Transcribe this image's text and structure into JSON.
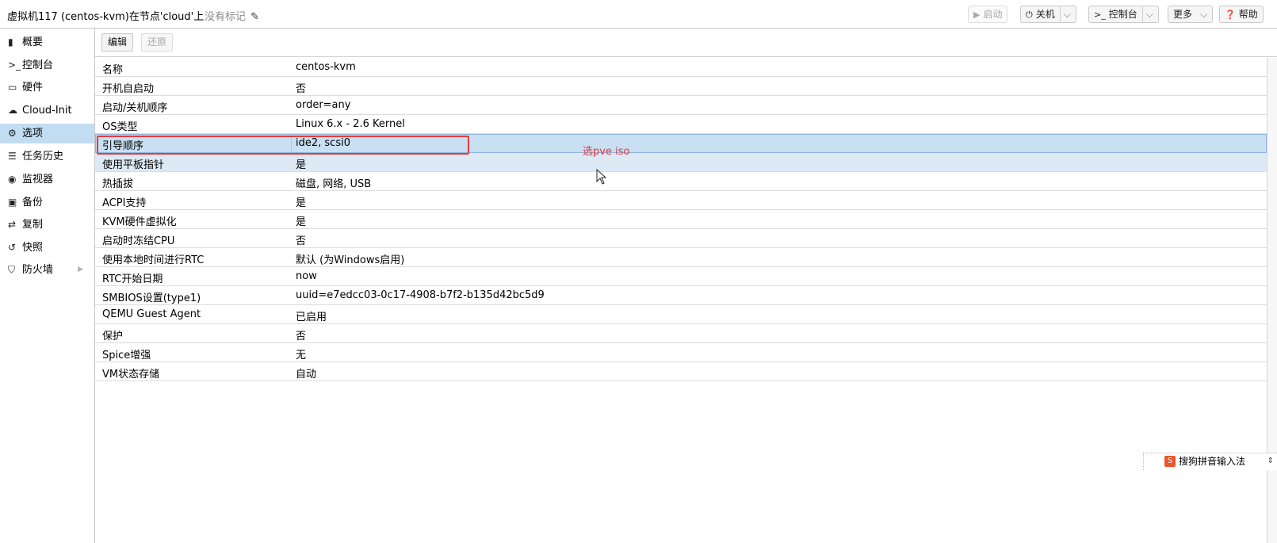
{
  "header": {
    "title": "虚拟机117 (centos-kvm)在节点'cloud'上",
    "tags": "没有标记",
    "buttons": {
      "start": "启动",
      "shutdown": "关机",
      "console": "控制台",
      "more": "更多",
      "help": "帮助"
    }
  },
  "sidebar": {
    "items": [
      {
        "label": "概要",
        "icon": "book-icon"
      },
      {
        "label": "控制台",
        "icon": "terminal-icon"
      },
      {
        "label": "硬件",
        "icon": "monitor-icon"
      },
      {
        "label": "Cloud-Init",
        "icon": "cloud-icon"
      },
      {
        "label": "选项",
        "icon": "gear-icon",
        "active": true
      },
      {
        "label": "任务历史",
        "icon": "list-icon"
      },
      {
        "label": "监视器",
        "icon": "eye-icon"
      },
      {
        "label": "备份",
        "icon": "floppy-icon"
      },
      {
        "label": "复制",
        "icon": "retweet-icon"
      },
      {
        "label": "快照",
        "icon": "history-icon"
      },
      {
        "label": "防火墙",
        "icon": "shield-icon"
      }
    ]
  },
  "toolbar": {
    "edit": "编辑",
    "revert": "还原"
  },
  "options": [
    {
      "key": "名称",
      "value": "centos-kvm"
    },
    {
      "key": "开机自启动",
      "value": "否"
    },
    {
      "key": "启动/关机顺序",
      "value": "order=any"
    },
    {
      "key": "OS类型",
      "value": "Linux 6.x - 2.6 Kernel"
    },
    {
      "key": "引导顺序",
      "value": "ide2, scsi0"
    },
    {
      "key": "使用平板指针",
      "value": "是"
    },
    {
      "key": "热插拔",
      "value": "磁盘, 网络, USB"
    },
    {
      "key": "ACPI支持",
      "value": "是"
    },
    {
      "key": "KVM硬件虚拟化",
      "value": "是"
    },
    {
      "key": "启动时冻结CPU",
      "value": "否"
    },
    {
      "key": "使用本地时间进行RTC",
      "value": "默认 (为Windows启用)"
    },
    {
      "key": "RTC开始日期",
      "value": "now"
    },
    {
      "key": "SMBIOS设置(type1)",
      "value": "uuid=e7edcc03-0c17-4908-b7f2-b135d42bc5d9"
    },
    {
      "key": "QEMU Guest Agent",
      "value": "已启用"
    },
    {
      "key": "保护",
      "value": "否"
    },
    {
      "key": "Spice增强",
      "value": "无"
    },
    {
      "key": "VM状态存储",
      "value": "自动"
    }
  ],
  "annotation": {
    "text": "选pve iso",
    "color": "#e53c3c"
  },
  "ime": {
    "label": "搜狗拼音输入法"
  }
}
